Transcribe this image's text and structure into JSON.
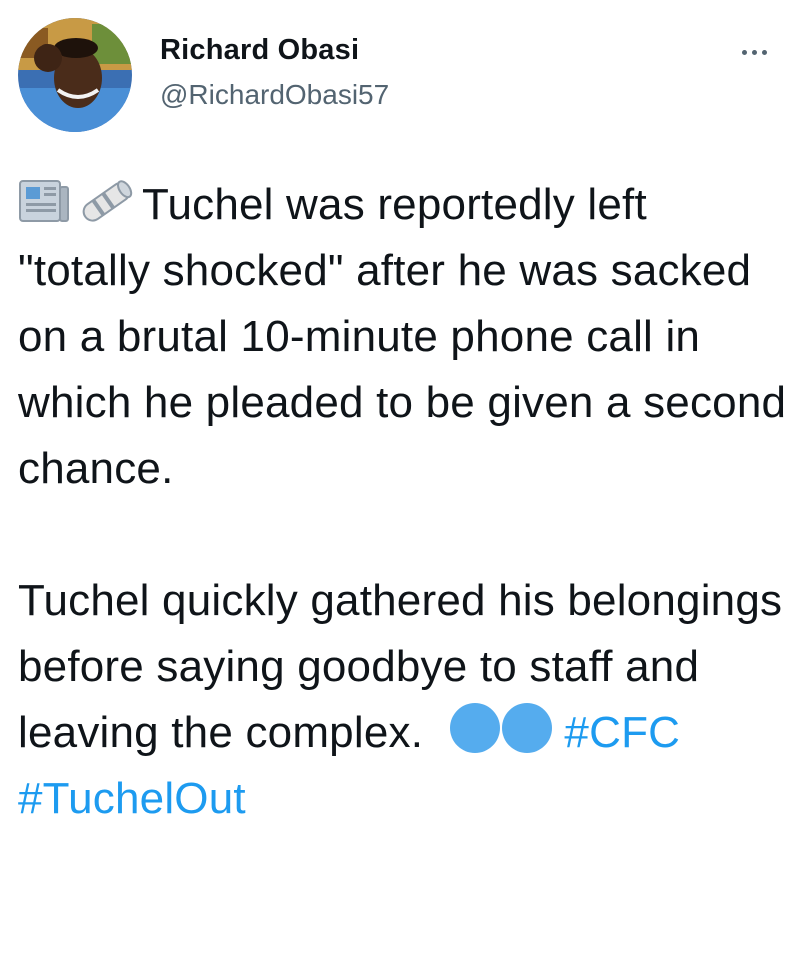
{
  "tweet": {
    "author": {
      "display_name": "Richard Obasi",
      "handle": "@RichardObasi57"
    },
    "icons": {
      "avatar": "profile-photo",
      "more": "more-options-icon",
      "newspaper": "newspaper-emoji",
      "rolled_newspaper": "rolled-newspaper-emoji",
      "blue_circle": "blue-circle-emoji"
    },
    "paragraph1": {
      "text": "Tuchel was reportedly left \"totally shocked\" after he was sacked on a brutal 10-minute phone call in which he pleaded to be given a second chance."
    },
    "paragraph2": {
      "text": "Tuchel quickly gathered his belongings before saying goodbye to staff and leaving the complex."
    },
    "hashtags": [
      "#CFC",
      "#TuchelOut"
    ],
    "colors": {
      "link": "#1d9bf0",
      "text": "#0f1419",
      "muted": "#536471",
      "blue_circle": "#55acee"
    }
  }
}
